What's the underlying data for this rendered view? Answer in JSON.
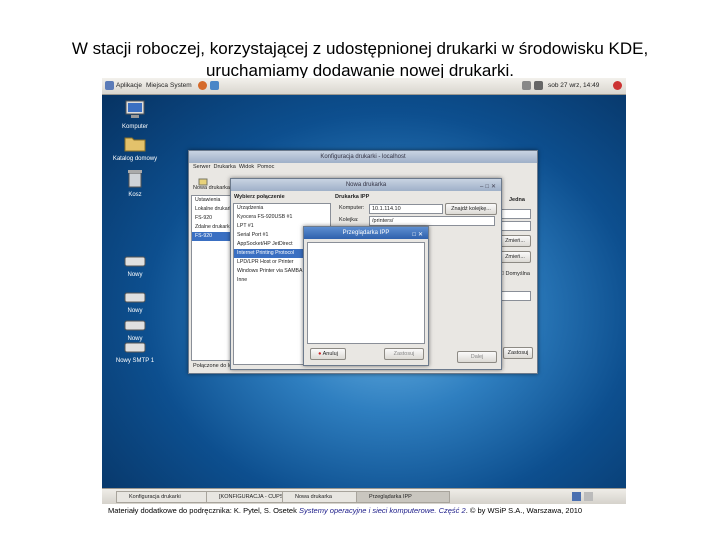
{
  "slide": {
    "title": "W stacji roboczej, korzystającej z udostępnionej drukarki w środowisku KDE, uruchamiamy dodawanie nowej drukarki.",
    "footer_prefix": "Materiały dodatkowe do podręcznika: K. Pytel, S. Osetek",
    "footer_book": "Systemy operacyjne i sieci komputerowe. Część 2",
    "footer_suffix": ". © by WSiP S.A., Warszawa, 2010"
  },
  "top_panel": {
    "menus": [
      "Aplikacje",
      "Miejsca",
      "System"
    ],
    "clock": "sob 27 wrz, 14:49"
  },
  "desktop_icons": [
    "Komputer",
    "Katalog domowy",
    "Kosz",
    "Nowy",
    "Nowy",
    "Nowy",
    "Nowy SMTP 1"
  ],
  "main_window": {
    "title": "Konfiguracja drukarki - localhost",
    "menus": [
      "Serwer",
      "Drukarka",
      "Widok",
      "Pomoc"
    ],
    "new_label": "Nowa drukarka",
    "tree": [
      "Ustawienia",
      "Lokalne drukarki",
      "FS-920",
      "Zdalne drukarki",
      "FS-920"
    ],
    "status": "Połączone do localhost",
    "side_buttons": [
      "Zmień...",
      "Zmień..."
    ],
    "right_tab": "Jedna",
    "checkbox_label": "Domyślna",
    "bottom_button": "Zastosuj"
  },
  "new_printer": {
    "title": "Nowa drukarka",
    "section_left": "Wybierz połączenie",
    "devices": [
      "Urządzenia",
      "Kyocera FS-920USB #1",
      "LPT #1",
      "Serial Port #1",
      "AppSocket/HP JetDirect",
      "Internet Printing Protocol",
      "LPD/LPR Host or Printer",
      "Windows Printer via SAMBA",
      "Inne"
    ],
    "section_right": "Drukarka IPP",
    "host_label": "Komputer:",
    "host_value": "10.1.114.10",
    "queue_label": "Kolejka:",
    "queue_value": "/printers/",
    "find_button": "Znajdź kolejkę...",
    "forward_button": "Dalej",
    "apply_button": "Zastosuj",
    "cancel_button": "Anuluj"
  },
  "ipp_browser": {
    "title": "Przeglądarka IPP"
  },
  "taskbar": {
    "tasks": [
      "Konfiguracja drukarki",
      "[KONFIGURACJA - CUPS 1.3]",
      "Nowa drukarka",
      "Przeglądarka IPP"
    ]
  },
  "colors": {
    "desktop_blue": "#0d4f8f",
    "active_title": "#2f61ac",
    "selection": "#3a6fc2"
  }
}
